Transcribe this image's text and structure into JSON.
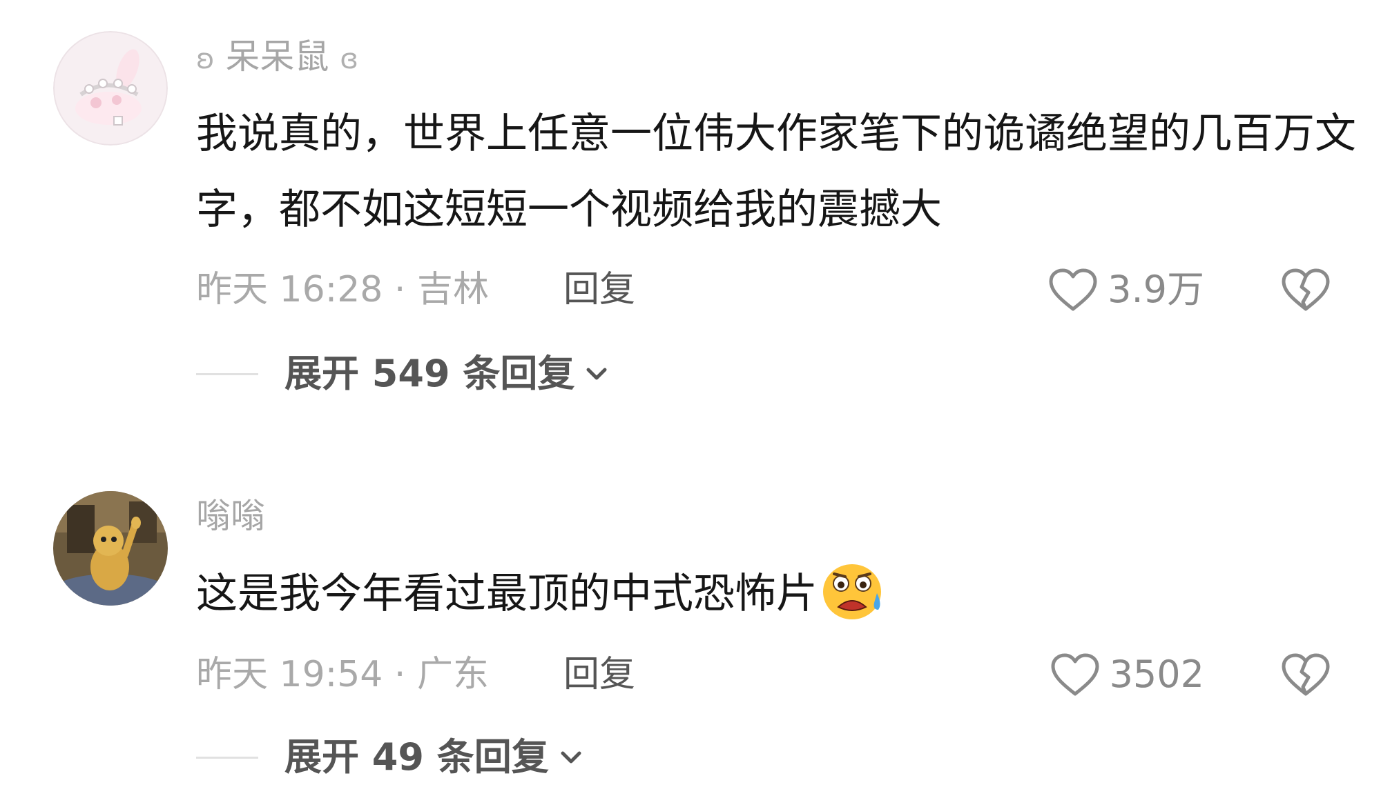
{
  "comments": [
    {
      "username": "呆呆鼠",
      "username_prefix": "ʚ",
      "username_suffix": "ɞ",
      "text": "我说真的，世界上任意一位伟大作家笔下的诡谲绝望的几百万文字，都不如这短短一个视频给我的震撼大",
      "time_location": "昨天 16:28 · 吉林",
      "reply_label": "回复",
      "like_count": "3.9万",
      "like_icon": "heart-outline-icon",
      "dislike_icon": "broken-heart-icon",
      "expand_label": "展开 549 条回复",
      "avatar_icon": "bunny-avatar"
    },
    {
      "username": "嗡嗡",
      "text": "这是我今年看过最顶的中式恐怖片",
      "emoji": "scared-crying-face-emoji",
      "time_location": "昨天 19:54 · 广东",
      "reply_label": "回复",
      "like_count": "3502",
      "like_icon": "heart-outline-icon",
      "dislike_icon": "broken-heart-icon",
      "expand_label": "展开 49 条回复",
      "avatar_icon": "cartoon-cat-avatar"
    }
  ]
}
